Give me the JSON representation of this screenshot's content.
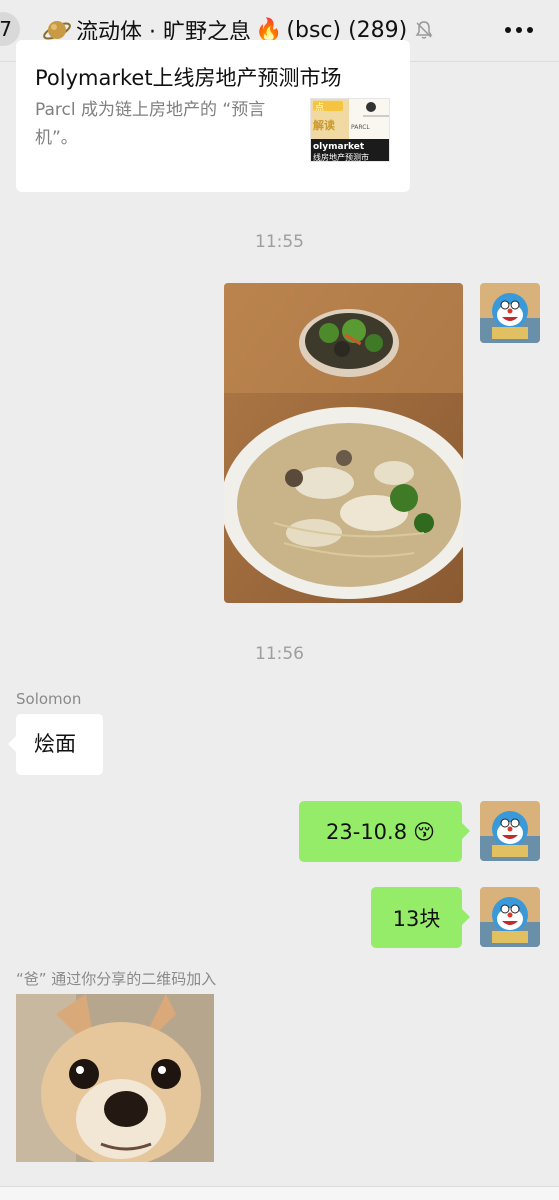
{
  "header": {
    "back_count": "7",
    "title": "流动体 · 旷野之息",
    "suffix": "(bsc) (289)",
    "icons": [
      "planet-icon",
      "fire-icon",
      "mute-bell-icon",
      "more-dots-icon"
    ]
  },
  "link_card": {
    "title": "Polymarket上线房地产预测市场",
    "description": "Parcl 成为链上房地产的 “预言机”。",
    "thumb_text_1": "点",
    "thumb_text_2": "解读",
    "thumb_text_3": "olymarket",
    "thumb_text_4": "线房地产预测市",
    "thumb_text_5": "PARCL"
  },
  "timestamps": [
    "11:55",
    "11:56"
  ],
  "messages": [
    {
      "sender": "Solomon",
      "text": "烩面"
    },
    {
      "text": "23-10.8",
      "emoji": "😚"
    },
    {
      "text": "13块"
    }
  ],
  "system_note": "“爸” 通过你分享的二维码加入",
  "colors": {
    "bg": "#ededed",
    "bubble_green": "#95ec69",
    "bubble_white": "#ffffff",
    "meta_text": "#9e9e9e"
  }
}
